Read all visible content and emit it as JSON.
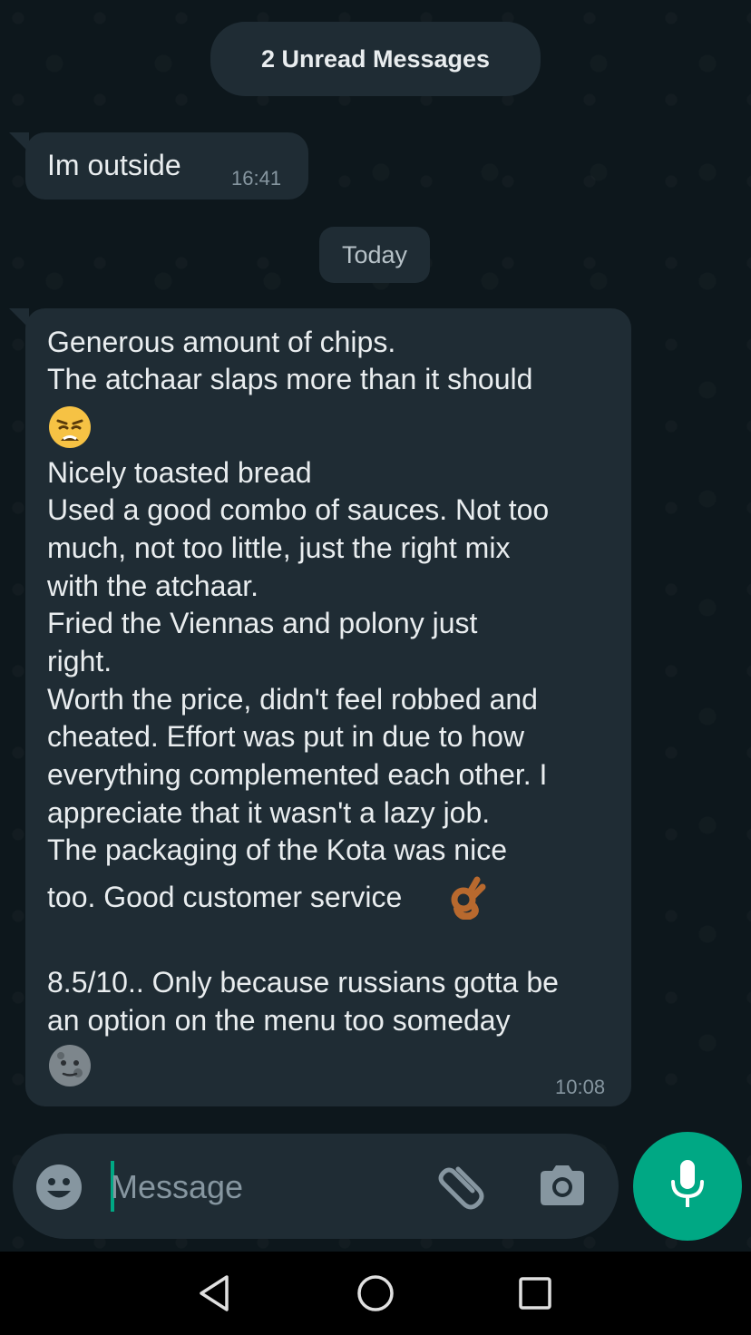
{
  "unread_banner": "2 Unread Messages",
  "messages": [
    {
      "text": "Im outside",
      "time": "16:41"
    },
    {
      "lines": [
        "Generous amount of chips.",
        "The atchaar slaps more than it should",
        "Nicely toasted bread",
        "Used a good combo of sauces. Not too",
        "much, not too little, just the right mix",
        "with the atchaar.",
        "Fried the Viennas and polony just",
        "right.",
        "Worth the price, didn't feel robbed and",
        "cheated. Effort was put in due to how",
        "everything complemented each other. I",
        "appreciate that it wasn't a lazy job.",
        "The packaging of the Kota was nice",
        "too. Good customer service",
        "8.5/10.. Only because russians gotta be",
        "an option on the menu too someday"
      ],
      "time": "10:08",
      "emojis": [
        "weary-face",
        "ok-hand",
        "new-moon-face"
      ]
    }
  ],
  "date_separator": "Today",
  "composer": {
    "placeholder": "Message"
  },
  "icons": {
    "emoji": "smiley-icon",
    "attach": "paperclip-icon",
    "camera": "camera-icon",
    "mic": "mic-icon",
    "nav_back": "back-triangle-icon",
    "nav_home": "home-circle-icon",
    "nav_recents": "recents-square-icon"
  },
  "colors": {
    "accent": "#00a884",
    "bubble": "#1f2c34",
    "background": "#0b141a",
    "muted": "#8696a0"
  }
}
